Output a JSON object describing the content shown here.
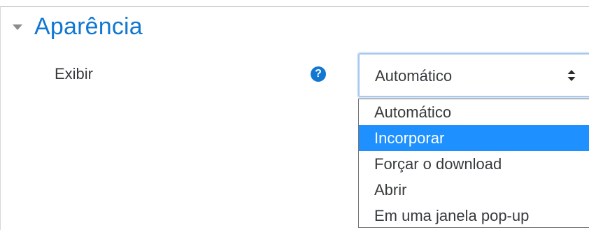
{
  "section": {
    "title": "Aparência",
    "icon": "caret-down-icon"
  },
  "field": {
    "label": "Exibir",
    "help_icon": "question-circle-icon",
    "help_glyph": "?"
  },
  "select": {
    "value": "Automático",
    "arrows_icon": "select-arrows-icon"
  },
  "dropdown": {
    "options": [
      {
        "label": "Automático",
        "highlighted": false
      },
      {
        "label": "Incorporar",
        "highlighted": true
      },
      {
        "label": "Forçar o download",
        "highlighted": false
      },
      {
        "label": "Abrir",
        "highlighted": false
      },
      {
        "label": "Em uma janela pop-up",
        "highlighted": false
      }
    ]
  },
  "colors": {
    "accent": "#1177d1",
    "highlight": "#1e90ff",
    "text": "#373a3c"
  }
}
